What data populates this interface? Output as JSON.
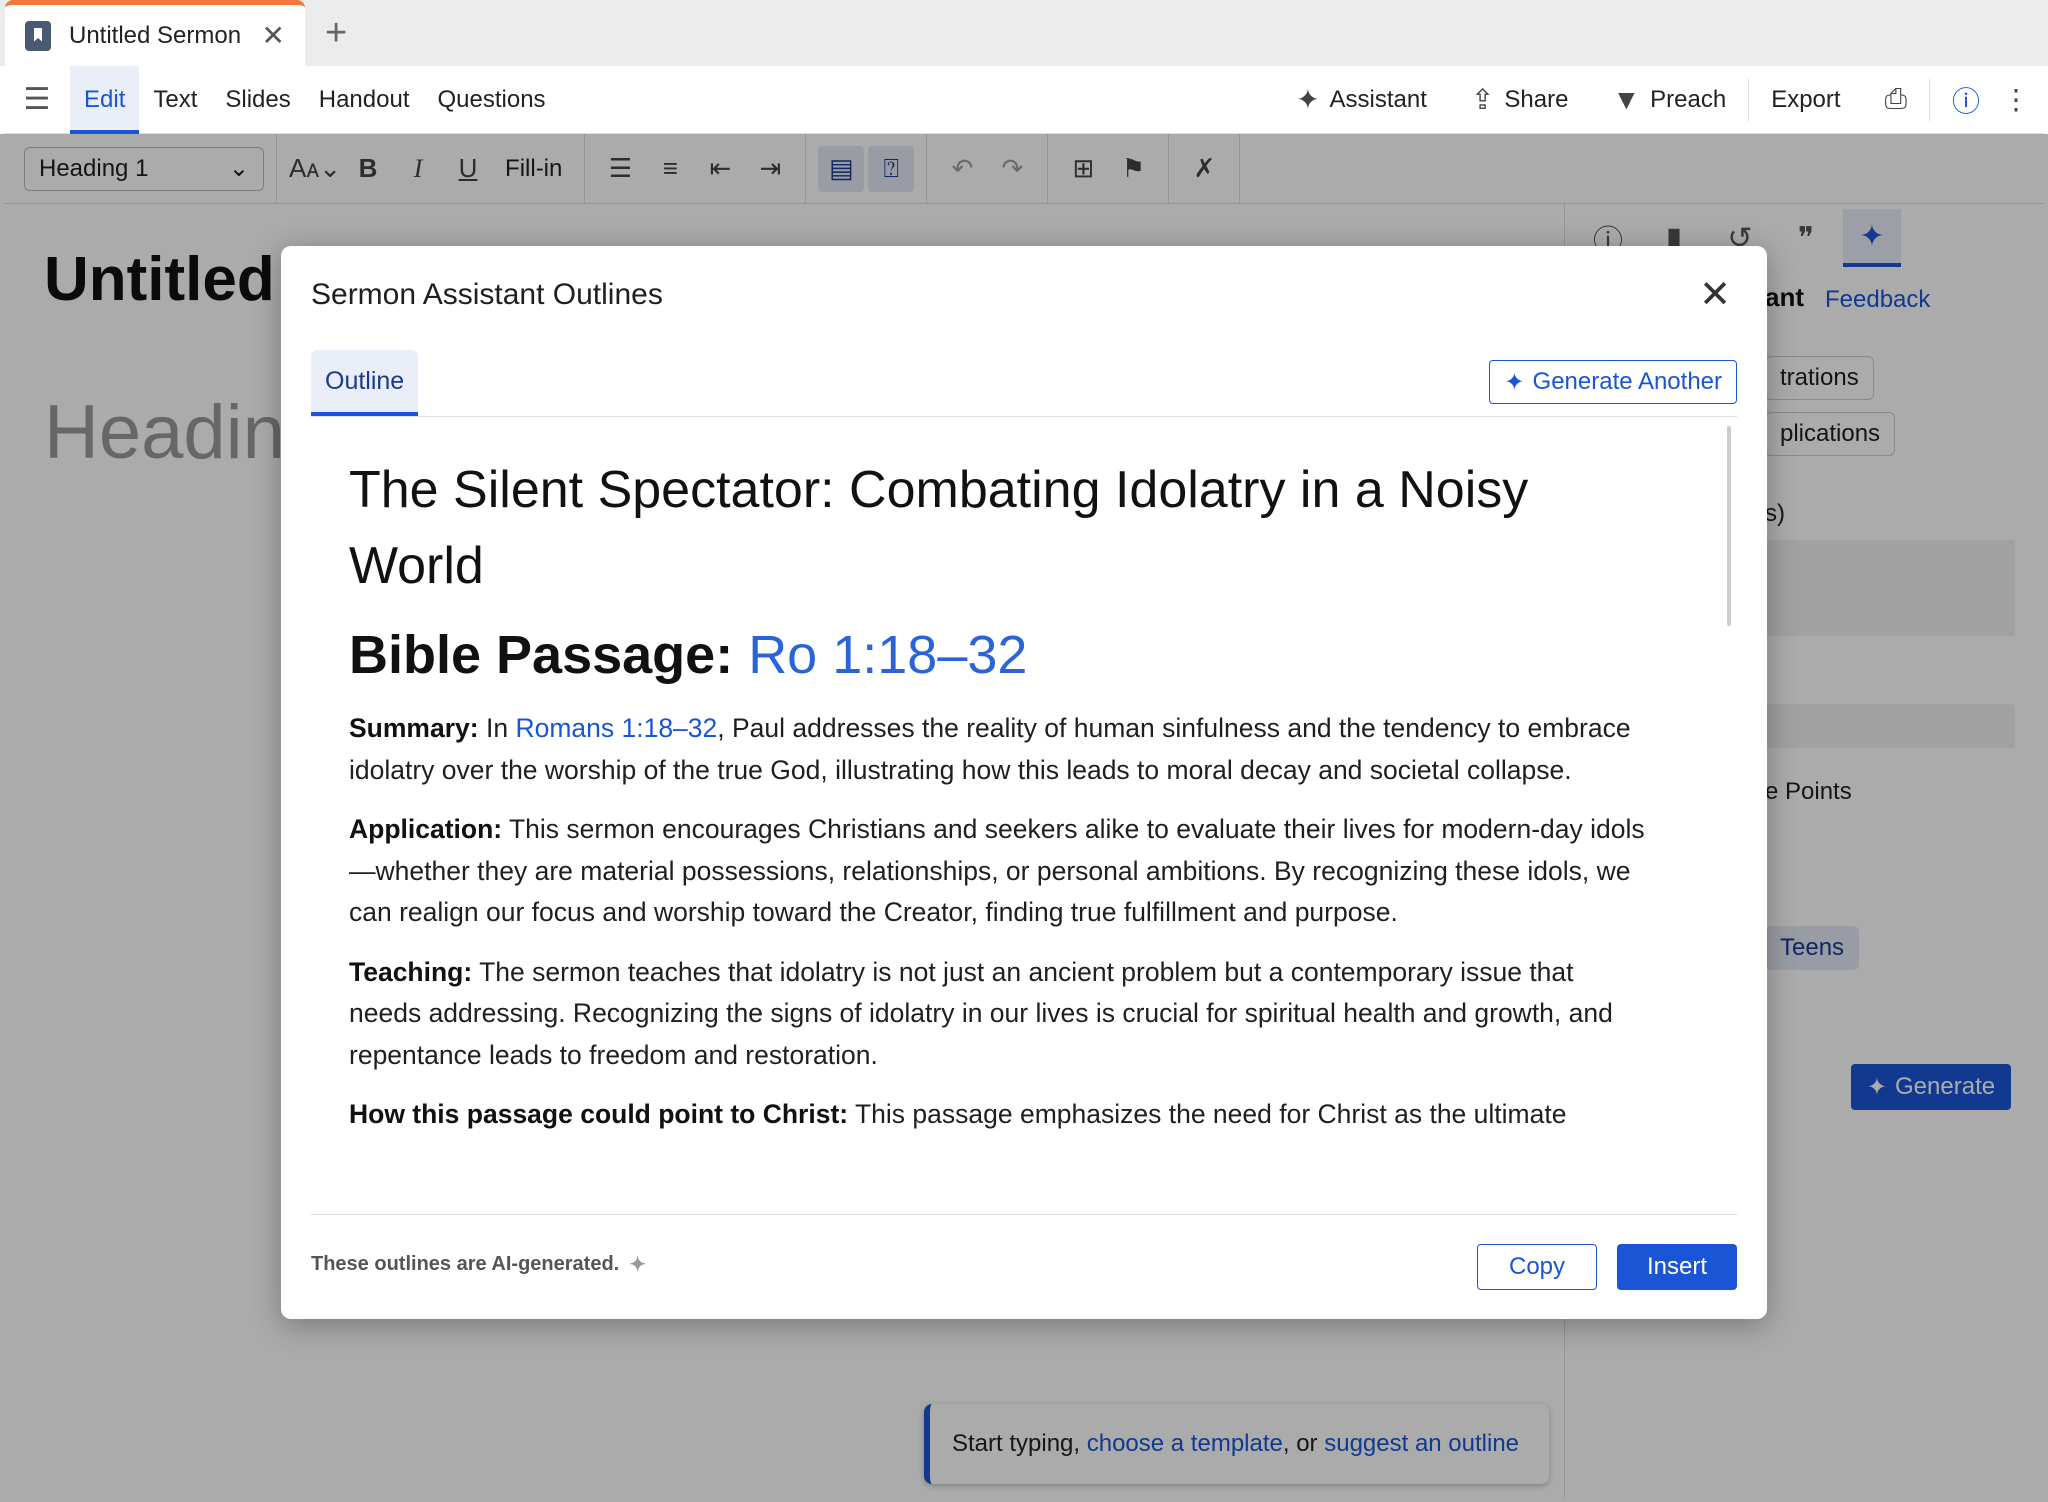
{
  "browser": {
    "tab_title": "Untitled Sermon",
    "close_glyph": "✕",
    "new_tab_glyph": "+"
  },
  "menubar": {
    "items": [
      "Edit",
      "Text",
      "Slides",
      "Handout",
      "Questions"
    ],
    "active": "Edit",
    "assistant": "Assistant",
    "share": "Share",
    "preach": "Preach",
    "export": "Export"
  },
  "toolbar": {
    "style_select": "Heading 1",
    "fill_in": "Fill-in"
  },
  "document": {
    "title": "Untitled Sermon",
    "heading_placeholder": "Heading",
    "prompt": {
      "prefix": "Start typing, ",
      "template_link": "choose a template",
      "middle": ", or ",
      "outline_link": "suggest an outline"
    }
  },
  "side_panel": {
    "header": "ant",
    "feedback": "Feedback",
    "chip_illustrations": "trations",
    "chip_applications": "plications",
    "label_s": "s)",
    "label_points": "e Points",
    "chip_teens": "Teens",
    "generate": "Generate"
  },
  "modal": {
    "title": "Sermon Assistant Outlines",
    "tab": "Outline",
    "generate_another": "Generate Another",
    "outline_title": "The Silent Spectator: Combating Idolatry in a Noisy World",
    "passage_label": "Bible Passage: ",
    "passage_ref": "Ro 1:18–32",
    "summary": {
      "label": "Summary:",
      "pre": " In ",
      "link": "Romans 1:18–32",
      "text": ", Paul addresses the reality of human sinfulness and the tendency to embrace idolatry over the worship of the true God, illustrating how this leads to moral decay and societal collapse."
    },
    "application": {
      "label": "Application:",
      "text": " This sermon encourages Christians and seekers alike to evaluate their lives for modern-day idols—whether they are material possessions, relationships, or personal ambitions. By recognizing these idols, we can realign our focus and worship toward the Creator, finding true fulfillment and purpose."
    },
    "teaching": {
      "label": "Teaching:",
      "text": " The sermon teaches that idolatry is not just an ancient problem but a contemporary issue that needs addressing. Recognizing the signs of idolatry in our lives is crucial for spiritual health and growth, and repentance leads to freedom and restoration."
    },
    "christ": {
      "label": "How this passage could point to Christ:",
      "text": " This passage emphasizes the need for Christ as the ultimate"
    },
    "disclaimer": "These outlines are AI-generated.",
    "copy": "Copy",
    "insert": "Insert"
  },
  "colors": {
    "accent": "#1a55d6",
    "tab_accent": "#f07a3a",
    "overlay": "rgba(0,0,0,0.33)"
  }
}
